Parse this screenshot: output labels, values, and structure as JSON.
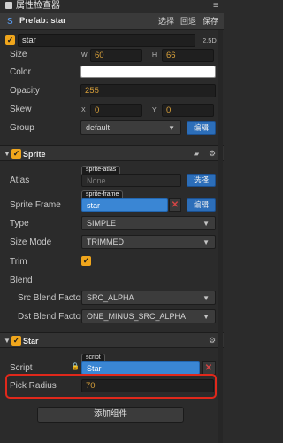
{
  "window": {
    "title": "属性检查器",
    "menu_glyph": "≡"
  },
  "header": {
    "prefab_icon": "S",
    "prefab_label": "Prefab: star",
    "select": "选择",
    "revert": "回退",
    "save": "保存"
  },
  "node": {
    "name": "star",
    "mode": "2.5D"
  },
  "size": {
    "label": "Size",
    "w_label": "W",
    "w": "60",
    "h_label": "H",
    "h": "66"
  },
  "color": {
    "label": "Color",
    "value": "#ffffff"
  },
  "opacity": {
    "label": "Opacity",
    "value": "255"
  },
  "skew": {
    "label": "Skew",
    "x_label": "X",
    "x": "0",
    "y_label": "Y",
    "y": "0"
  },
  "group": {
    "label": "Group",
    "value": "default",
    "edit": "编辑"
  },
  "sprite": {
    "title": "Sprite",
    "atlas": {
      "label": "Atlas",
      "tag": "sprite-atlas",
      "value": "None",
      "button": "选择"
    },
    "frame": {
      "label": "Sprite Frame",
      "tag": "sprite-frame",
      "value": "star",
      "button": "编辑"
    },
    "type": {
      "label": "Type",
      "value": "SIMPLE"
    },
    "size_mode": {
      "label": "Size Mode",
      "value": "TRIMMED"
    },
    "trim": {
      "label": "Trim"
    },
    "blend": {
      "label": "Blend"
    },
    "src": {
      "label": "Src Blend Factor",
      "value": "SRC_ALPHA"
    },
    "dst": {
      "label": "Dst Blend Factor",
      "value": "ONE_MINUS_SRC_ALPHA"
    }
  },
  "star": {
    "title": "Star",
    "script": {
      "label": "Script",
      "tag": "script",
      "value": "Star"
    },
    "pick_radius": {
      "label": "Pick Radius",
      "value": "70"
    }
  },
  "add_component": "添加组件",
  "colors": {
    "accent": "#f0a61c",
    "blue": "#2c6eb9",
    "highlight": "#e0281b"
  }
}
